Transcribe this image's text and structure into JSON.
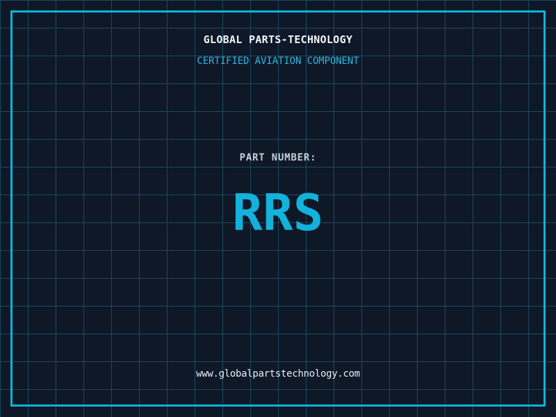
{
  "colors": {
    "background": "#0e1827",
    "grid_line": "#1d4a61",
    "frame": "#0db3dc",
    "title": "#f2f5f8",
    "subtitle": "#29b7e0",
    "part_label": "#c3ced9",
    "part_number": "#13b2dc",
    "url": "#e9eef3"
  },
  "header": {
    "title": "GLOBAL PARTS-TECHNOLOGY",
    "subtitle": "CERTIFIED AVIATION COMPONENT"
  },
  "part": {
    "label": "PART NUMBER:",
    "number": "RRS"
  },
  "footer": {
    "url": "www.globalpartstechnology.com"
  }
}
